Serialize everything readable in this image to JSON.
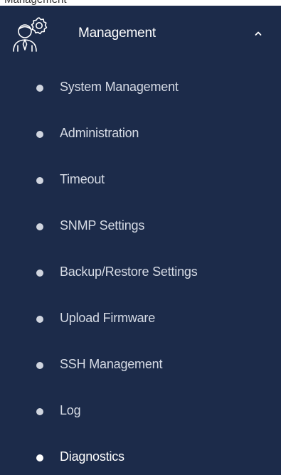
{
  "top_strip_text": "Management",
  "group": {
    "title": "Management",
    "expanded": true,
    "icon": "admin-gear-icon"
  },
  "menu": {
    "items": [
      {
        "label": "System Management"
      },
      {
        "label": "Administration"
      },
      {
        "label": "Timeout"
      },
      {
        "label": "SNMP Settings"
      },
      {
        "label": "Backup/Restore Settings"
      },
      {
        "label": "Upload Firmware"
      },
      {
        "label": "SSH Management"
      },
      {
        "label": "Log"
      },
      {
        "label": "Diagnostics"
      }
    ],
    "active_index": 8
  },
  "colors": {
    "sidebar_bg": "#1c2b4a",
    "text": "#d6dbe5",
    "active_text": "#ffffff"
  }
}
